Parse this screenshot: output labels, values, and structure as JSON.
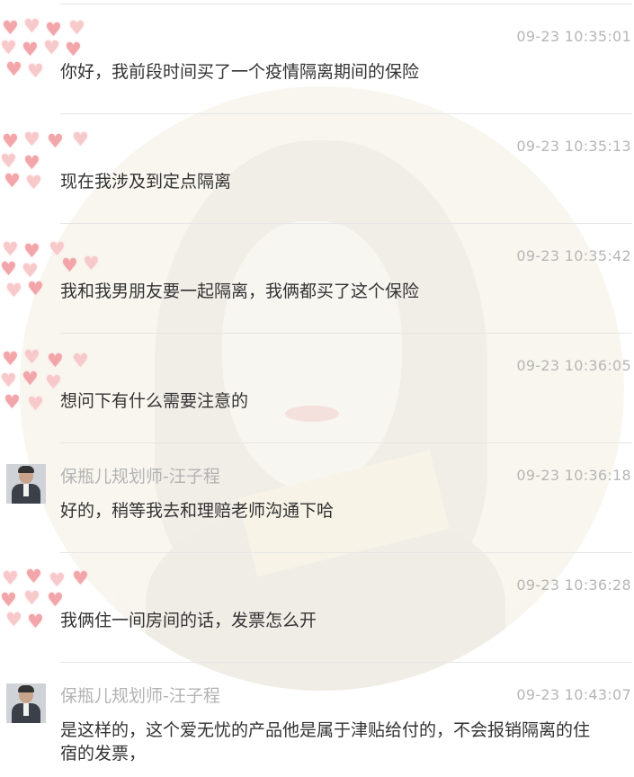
{
  "messages": [
    {
      "sender": "",
      "time": "09-23 10:35:01",
      "text": "你好，我前段时间买了一个疫情隔离期间的保险",
      "avatar": "hearts-avatar"
    },
    {
      "sender": "",
      "time": "09-23 10:35:13",
      "text": "现在我涉及到定点隔离",
      "avatar": "hearts-avatar"
    },
    {
      "sender": "",
      "time": "09-23 10:35:42",
      "text": "我和我男朋友要一起隔离，我俩都买了这个保险",
      "avatar": "hearts-avatar"
    },
    {
      "sender": "",
      "time": "09-23 10:36:05",
      "text": "想问下有什么需要注意的",
      "avatar": "hearts-avatar"
    },
    {
      "sender": "保瓶儿规划师-汪子程",
      "time": "09-23 10:36:18",
      "text": "好的，稍等我去和理赔老师沟通下哈",
      "avatar": "person-avatar"
    },
    {
      "sender": "",
      "time": "09-23 10:36:28",
      "text": "我俩住一间房间的话，发票怎么开",
      "avatar": "hearts-avatar"
    },
    {
      "sender": "保瓶儿规划师-汪子程",
      "time": "09-23 10:43:07",
      "text": "是这样的，这个爱无忧的产品他是属于津贴给付的，不会报销隔离的住宿的发票，",
      "avatar": "person-avatar"
    }
  ],
  "colors": {
    "text": "#333333",
    "meta": "#b6b6b6",
    "divider": "#e6e6e6",
    "heart": "#f2a6aa"
  }
}
